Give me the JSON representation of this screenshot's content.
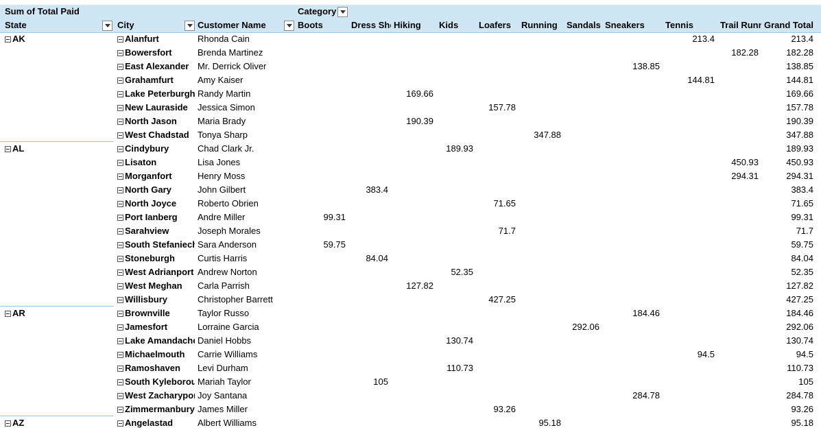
{
  "pivot": {
    "value_label": "Sum of Total Paid",
    "columns_field": "Category",
    "row_headers": [
      "State",
      "City",
      "Customer Name"
    ],
    "categories": [
      "Boots",
      "Dress Shoes",
      "Hiking",
      "Kids",
      "Loafers",
      "Running",
      "Sandals",
      "Sneakers",
      "Tennis",
      "Trail Running"
    ],
    "grand_total_label": "Grand Total",
    "rows": [
      {
        "state": "AK",
        "city": "Alanfurt",
        "customer": "Rhonda Cain",
        "values": {
          "Tennis": "213.4"
        },
        "total": "213.4"
      },
      {
        "state": "",
        "city": "Bowersfort",
        "customer": "Brenda Martinez",
        "values": {
          "Trail Running": "182.28"
        },
        "total": "182.28"
      },
      {
        "state": "",
        "city": "East Alexander",
        "customer": "Mr. Derrick Oliver",
        "values": {
          "Sneakers": "138.85"
        },
        "total": "138.85"
      },
      {
        "state": "",
        "city": "Grahamfurt",
        "customer": "Amy Kaiser",
        "values": {
          "Tennis": "144.81"
        },
        "total": "144.81"
      },
      {
        "state": "",
        "city": "Lake Peterburgh",
        "customer": "Randy Martin",
        "values": {
          "Hiking": "169.66"
        },
        "total": "169.66"
      },
      {
        "state": "",
        "city": "New Lauraside",
        "customer": "Jessica Simon",
        "values": {
          "Loafers": "157.78"
        },
        "total": "157.78"
      },
      {
        "state": "",
        "city": "North Jason",
        "customer": "Maria Brady",
        "values": {
          "Hiking": "190.39"
        },
        "total": "190.39"
      },
      {
        "state": "",
        "city": "West Chadstad",
        "customer": "Tonya Sharp",
        "values": {
          "Running": "347.88"
        },
        "total": "347.88"
      },
      {
        "state": "AL",
        "city": "Cindybury",
        "customer": "Chad Clark Jr.",
        "values": {
          "Kids": "189.93"
        },
        "total": "189.93"
      },
      {
        "state": "",
        "city": "Lisaton",
        "customer": "Lisa Jones",
        "values": {
          "Trail Running": "450.93"
        },
        "total": "450.93"
      },
      {
        "state": "",
        "city": "Morganfort",
        "customer": "Henry Moss",
        "values": {
          "Trail Running": "294.31"
        },
        "total": "294.31"
      },
      {
        "state": "",
        "city": "North Gary",
        "customer": "John Gilbert",
        "values": {
          "Dress Shoes": "383.4"
        },
        "total": "383.4"
      },
      {
        "state": "",
        "city": "North Joyce",
        "customer": "Roberto Obrien",
        "values": {
          "Loafers": "71.65"
        },
        "total": "71.65"
      },
      {
        "state": "",
        "city": "Port Ianberg",
        "customer": "Andre Miller",
        "values": {
          "Boots": "99.31"
        },
        "total": "99.31"
      },
      {
        "state": "",
        "city": "Sarahview",
        "customer": "Joseph Morales",
        "values": {
          "Loafers": "71.7"
        },
        "total": "71.7"
      },
      {
        "state": "",
        "city": "South Stefaniechester",
        "customer": "Sara Anderson",
        "values": {
          "Boots": "59.75"
        },
        "total": "59.75"
      },
      {
        "state": "",
        "city": "Stoneburgh",
        "customer": "Curtis Harris",
        "values": {
          "Dress Shoes": "84.04"
        },
        "total": "84.04"
      },
      {
        "state": "",
        "city": "West Adrianport",
        "customer": "Andrew Norton",
        "values": {
          "Kids": "52.35"
        },
        "total": "52.35"
      },
      {
        "state": "",
        "city": "West Meghan",
        "customer": "Carla Parrish",
        "values": {
          "Hiking": "127.82"
        },
        "total": "127.82"
      },
      {
        "state": "",
        "city": "Willisbury",
        "customer": "Christopher Barrett",
        "values": {
          "Loafers": "427.25"
        },
        "total": "427.25"
      },
      {
        "state": "AR",
        "city": "Brownville",
        "customer": "Taylor Russo",
        "values": {
          "Sneakers": "184.46"
        },
        "total": "184.46"
      },
      {
        "state": "",
        "city": "Jamesfort",
        "customer": "Lorraine Garcia",
        "values": {
          "Sandals": "292.06"
        },
        "total": "292.06"
      },
      {
        "state": "",
        "city": "Lake Amandachester",
        "customer": "Daniel Hobbs",
        "values": {
          "Kids": "130.74"
        },
        "total": "130.74"
      },
      {
        "state": "",
        "city": "Michaelmouth",
        "customer": "Carrie Williams",
        "values": {
          "Tennis": "94.5"
        },
        "total": "94.5"
      },
      {
        "state": "",
        "city": "Ramoshaven",
        "customer": "Levi Durham",
        "values": {
          "Kids": "110.73"
        },
        "total": "110.73"
      },
      {
        "state": "",
        "city": "South Kyleborough",
        "customer": "Mariah Taylor",
        "values": {
          "Dress Shoes": "105"
        },
        "total": "105"
      },
      {
        "state": "",
        "city": "West Zacharyport",
        "customer": "Joy Santana",
        "values": {
          "Sneakers": "284.78"
        },
        "total": "284.78"
      },
      {
        "state": "",
        "city": "Zimmermanbury",
        "customer": "James Miller",
        "values": {
          "Loafers": "93.26"
        },
        "total": "93.26"
      },
      {
        "state": "AZ",
        "city": "Angelastad",
        "customer": "Albert Williams",
        "values": {
          "Running": "95.18"
        },
        "total": "95.18"
      }
    ]
  }
}
